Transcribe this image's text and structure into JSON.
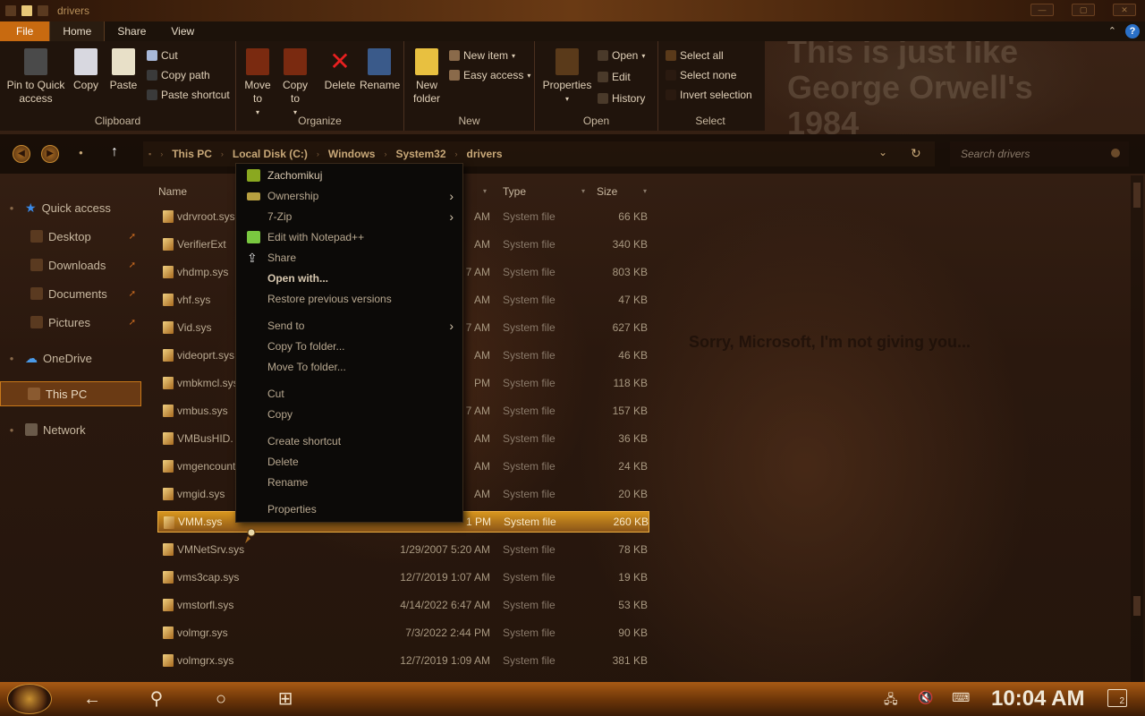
{
  "window": {
    "title": "drivers"
  },
  "ribbon_tabs": [
    "File",
    "Home",
    "Share",
    "View"
  ],
  "ribbon": {
    "clipboard": {
      "label": "Clipboard",
      "pin": "Pin to Quick access",
      "copy": "Copy",
      "paste": "Paste",
      "cut": "Cut",
      "copy_path": "Copy path",
      "paste_shortcut": "Paste shortcut"
    },
    "organize": {
      "label": "Organize",
      "move_to": "Move to",
      "copy_to": "Copy to",
      "delete": "Delete",
      "rename": "Rename"
    },
    "new": {
      "label": "New",
      "new_folder": "New folder",
      "new_item": "New item",
      "easy_access": "Easy access"
    },
    "open": {
      "label": "Open",
      "properties": "Properties",
      "open": "Open",
      "edit": "Edit",
      "history": "History"
    },
    "select": {
      "label": "Select",
      "select_all": "Select all",
      "select_none": "Select none",
      "invert": "Invert selection"
    }
  },
  "wallpaper_text": {
    "line1": "This is just like",
    "line2": "George Orwell's",
    "line3": "1984",
    "line4": "Sorry, Microsoft, I'm not giving you..."
  },
  "address": {
    "crumbs": [
      "This PC",
      "Local Disk (C:)",
      "Windows",
      "System32",
      "drivers"
    ],
    "search_placeholder": "Search drivers"
  },
  "nav": {
    "items": [
      {
        "label": "Quick access",
        "level": 0
      },
      {
        "label": "Desktop",
        "level": 1
      },
      {
        "label": "Downloads",
        "level": 1
      },
      {
        "label": "Documents",
        "level": 1
      },
      {
        "label": "Pictures",
        "level": 1
      },
      {
        "label": "OneDrive",
        "level": 0
      },
      {
        "label": "This PC",
        "level": 0
      },
      {
        "label": "Network",
        "level": 0
      }
    ]
  },
  "columns": {
    "name": "Name",
    "type": "Type",
    "size": "Size"
  },
  "files": [
    {
      "name": "vdrvroot.sys",
      "date": "AM",
      "type": "System file",
      "size": "66 KB"
    },
    {
      "name": "VerifierExt",
      "date": "AM",
      "type": "System file",
      "size": "340 KB"
    },
    {
      "name": "vhdmp.sys",
      "date": "7 AM",
      "type": "System file",
      "size": "803 KB"
    },
    {
      "name": "vhf.sys",
      "date": "AM",
      "type": "System file",
      "size": "47 KB"
    },
    {
      "name": "Vid.sys",
      "date": "7 AM",
      "type": "System file",
      "size": "627 KB"
    },
    {
      "name": "videoprt.sys",
      "date": "AM",
      "type": "System file",
      "size": "46 KB"
    },
    {
      "name": "vmbkmcl.sys",
      "date": "PM",
      "type": "System file",
      "size": "118 KB"
    },
    {
      "name": "vmbus.sys",
      "date": "7 AM",
      "type": "System file",
      "size": "157 KB"
    },
    {
      "name": "VMBusHID.",
      "date": "AM",
      "type": "System file",
      "size": "36 KB"
    },
    {
      "name": "vmgencounte",
      "date": "AM",
      "type": "System file",
      "size": "24 KB"
    },
    {
      "name": "vmgid.sys",
      "date": "AM",
      "type": "System file",
      "size": "20 KB"
    },
    {
      "name": "VMM.sys",
      "date": "1 PM",
      "type": "System file",
      "size": "260 KB"
    },
    {
      "name": "VMNetSrv.sys",
      "date": "1/29/2007 5:20 AM",
      "type": "System file",
      "size": "78 KB"
    },
    {
      "name": "vms3cap.sys",
      "date": "12/7/2019 1:07 AM",
      "type": "System file",
      "size": "19 KB"
    },
    {
      "name": "vmstorfl.sys",
      "date": "4/14/2022 6:47 AM",
      "type": "System file",
      "size": "53 KB"
    },
    {
      "name": "volmgr.sys",
      "date": "7/3/2022 2:44 PM",
      "type": "System file",
      "size": "90 KB"
    },
    {
      "name": "volmgrx.sys",
      "date": "12/7/2019 1:09 AM",
      "type": "System file",
      "size": "381 KB"
    }
  ],
  "context_menu": [
    {
      "label": "Zachomikuj",
      "submenu": false
    },
    {
      "label": "Ownership",
      "submenu": true
    },
    {
      "label": "7-Zip",
      "submenu": true
    },
    {
      "label": "Edit with Notepad++",
      "submenu": false
    },
    {
      "label": "Share",
      "submenu": false
    },
    {
      "label": "Open with...",
      "submenu": false
    },
    {
      "label": "Restore previous versions",
      "submenu": false
    },
    {
      "label": "Send to",
      "submenu": true
    },
    {
      "label": "Copy To folder...",
      "submenu": false
    },
    {
      "label": "Move To folder...",
      "submenu": false
    },
    {
      "label": "Cut",
      "submenu": false
    },
    {
      "label": "Copy",
      "submenu": false
    },
    {
      "label": "Create shortcut",
      "submenu": false
    },
    {
      "label": "Delete",
      "submenu": false
    },
    {
      "label": "Rename",
      "submenu": false
    },
    {
      "label": "Properties",
      "submenu": false
    }
  ],
  "taskbar": {
    "clock": "10:04 AM",
    "notification_count": "2"
  }
}
